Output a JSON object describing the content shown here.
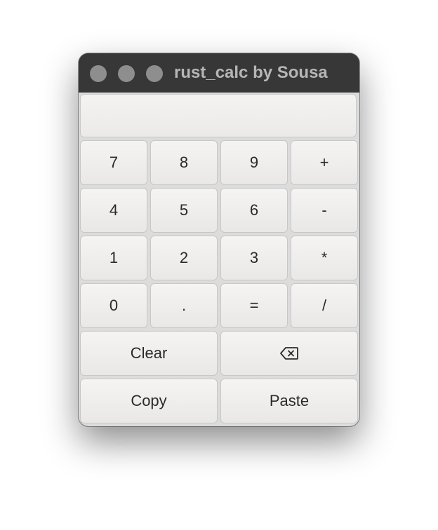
{
  "window": {
    "title": "rust_calc by Sousa"
  },
  "display": {
    "value": ""
  },
  "keypad": {
    "row1": [
      "7",
      "8",
      "9",
      "+"
    ],
    "row2": [
      "4",
      "5",
      "6",
      "-"
    ],
    "row3": [
      "1",
      "2",
      "3",
      "*"
    ],
    "row4": [
      "0",
      ".",
      "=",
      "/"
    ],
    "clear_label": "Clear",
    "backspace_icon": "backspace-icon",
    "copy_label": "Copy",
    "paste_label": "Paste"
  },
  "colors": {
    "titlebar": "#373737",
    "button_face": "#f0efed",
    "text": "#2a2a2a"
  }
}
